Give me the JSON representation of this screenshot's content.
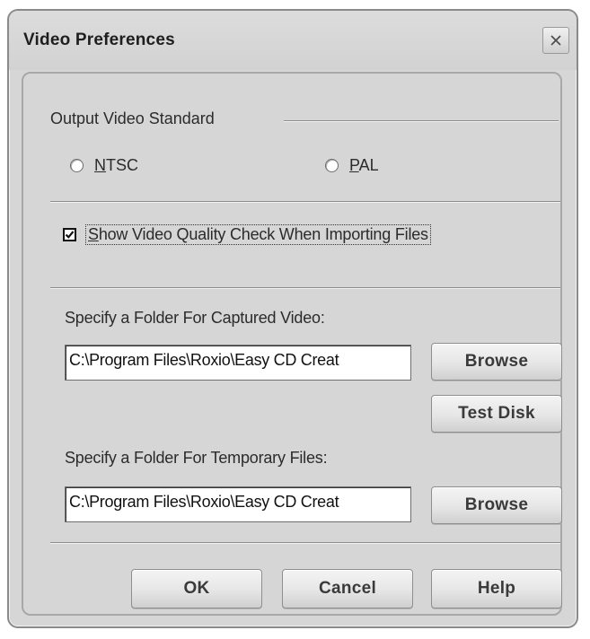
{
  "window": {
    "title": "Video Preferences",
    "close_icon": "close-icon"
  },
  "output_standard": {
    "group_label": "Output Video Standard",
    "options": [
      {
        "label_prefix": "",
        "label_access": "N",
        "label_rest": "TSC",
        "selected": false
      },
      {
        "label_prefix": "",
        "label_access": "P",
        "label_rest": "AL",
        "selected": false
      }
    ]
  },
  "quality_check": {
    "label_access": "S",
    "label_rest": "how Video Quality Check When Importing Files",
    "checked": true
  },
  "captured_folder": {
    "label": "Specify a Folder For Captured Video:",
    "value": "C:\\Program Files\\Roxio\\Easy CD Creat",
    "browse_label": "Browse",
    "test_disk_label": "Test Disk"
  },
  "temp_folder": {
    "label": "Specify a Folder For Temporary Files:",
    "value": "C:\\Program Files\\Roxio\\Easy CD Creat",
    "browse_label": "Browse"
  },
  "footer": {
    "ok_label": "OK",
    "cancel_label": "Cancel",
    "help_label": "Help"
  }
}
